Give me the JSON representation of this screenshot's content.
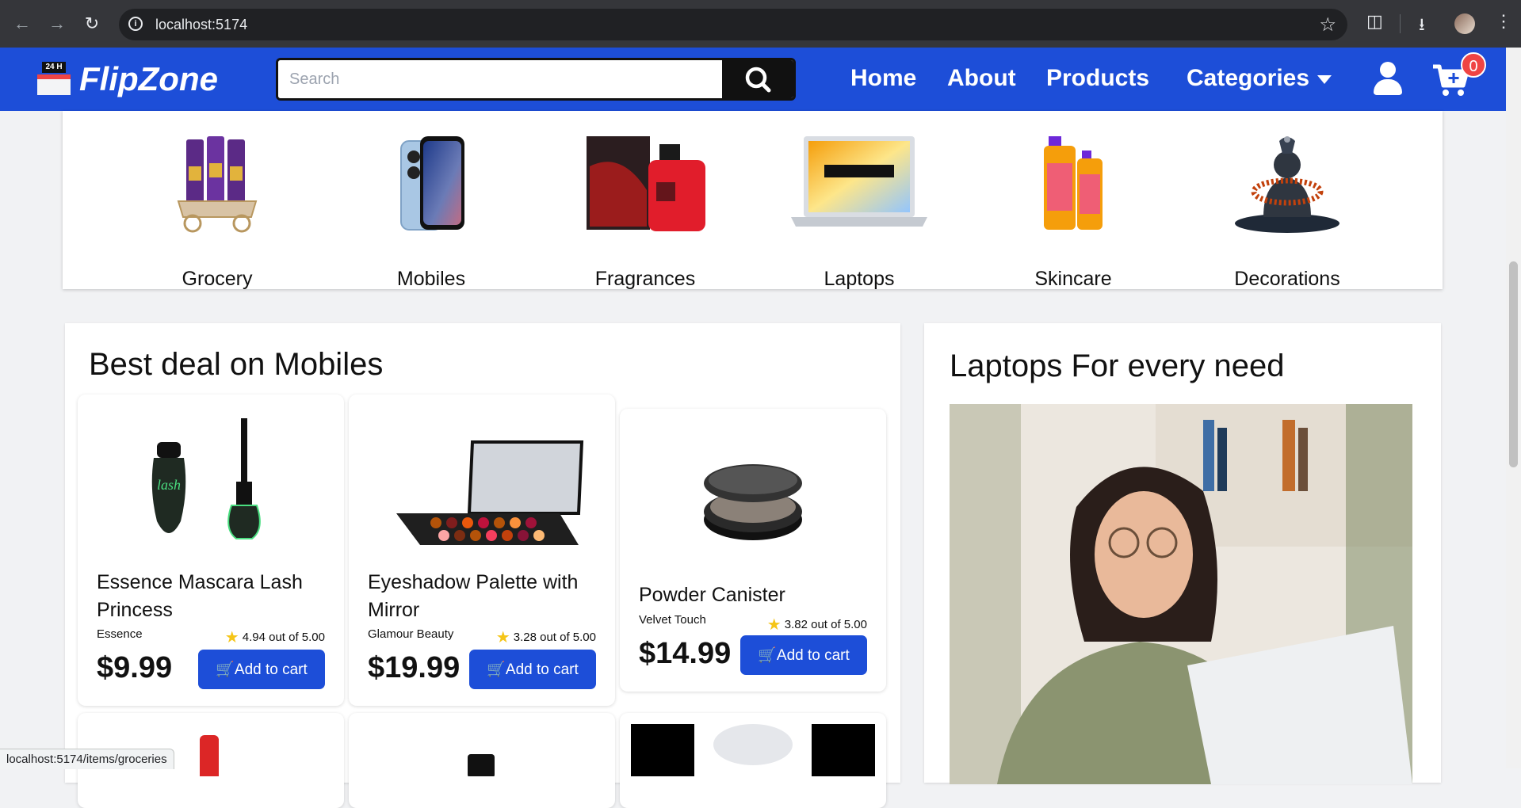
{
  "browser": {
    "url": "localhost:5174",
    "status_url": "localhost:5174/items/groceries"
  },
  "header": {
    "logo_sign": "24 H",
    "logo_text": "FlipZone",
    "search_placeholder": "Search",
    "nav": {
      "home": "Home",
      "about": "About",
      "products": "Products",
      "categories": "Categories"
    },
    "cart_count": "0",
    "brand_color": "#1d4ed8"
  },
  "categories": [
    {
      "label": "Grocery",
      "icon": "chocolate-cart-image"
    },
    {
      "label": "Mobiles",
      "icon": "phone-image"
    },
    {
      "label": "Fragrances",
      "icon": "perfume-image"
    },
    {
      "label": "Laptops",
      "icon": "laptop-image"
    },
    {
      "label": "Skincare",
      "icon": "cleanser-bottles-image"
    },
    {
      "label": "Decorations",
      "icon": "statue-image"
    }
  ],
  "deals": {
    "title": "Best deal on Mobiles",
    "products": [
      {
        "name": "Essence Mascara Lash Princess",
        "brand": "Essence",
        "rating": "4.94 out of 5.00",
        "price": "$9.99",
        "cta": "Add to cart"
      },
      {
        "name": "Eyeshadow Palette with Mirror",
        "brand": "Glamour Beauty",
        "rating": "3.28 out of 5.00",
        "price": "$19.99",
        "cta": "Add to cart"
      },
      {
        "name": "Powder Canister",
        "brand": "Velvet Touch",
        "rating": "3.82 out of 5.00",
        "price": "$14.99",
        "cta": "Add to cart"
      }
    ]
  },
  "laptops": {
    "title": "Laptops For every need"
  }
}
